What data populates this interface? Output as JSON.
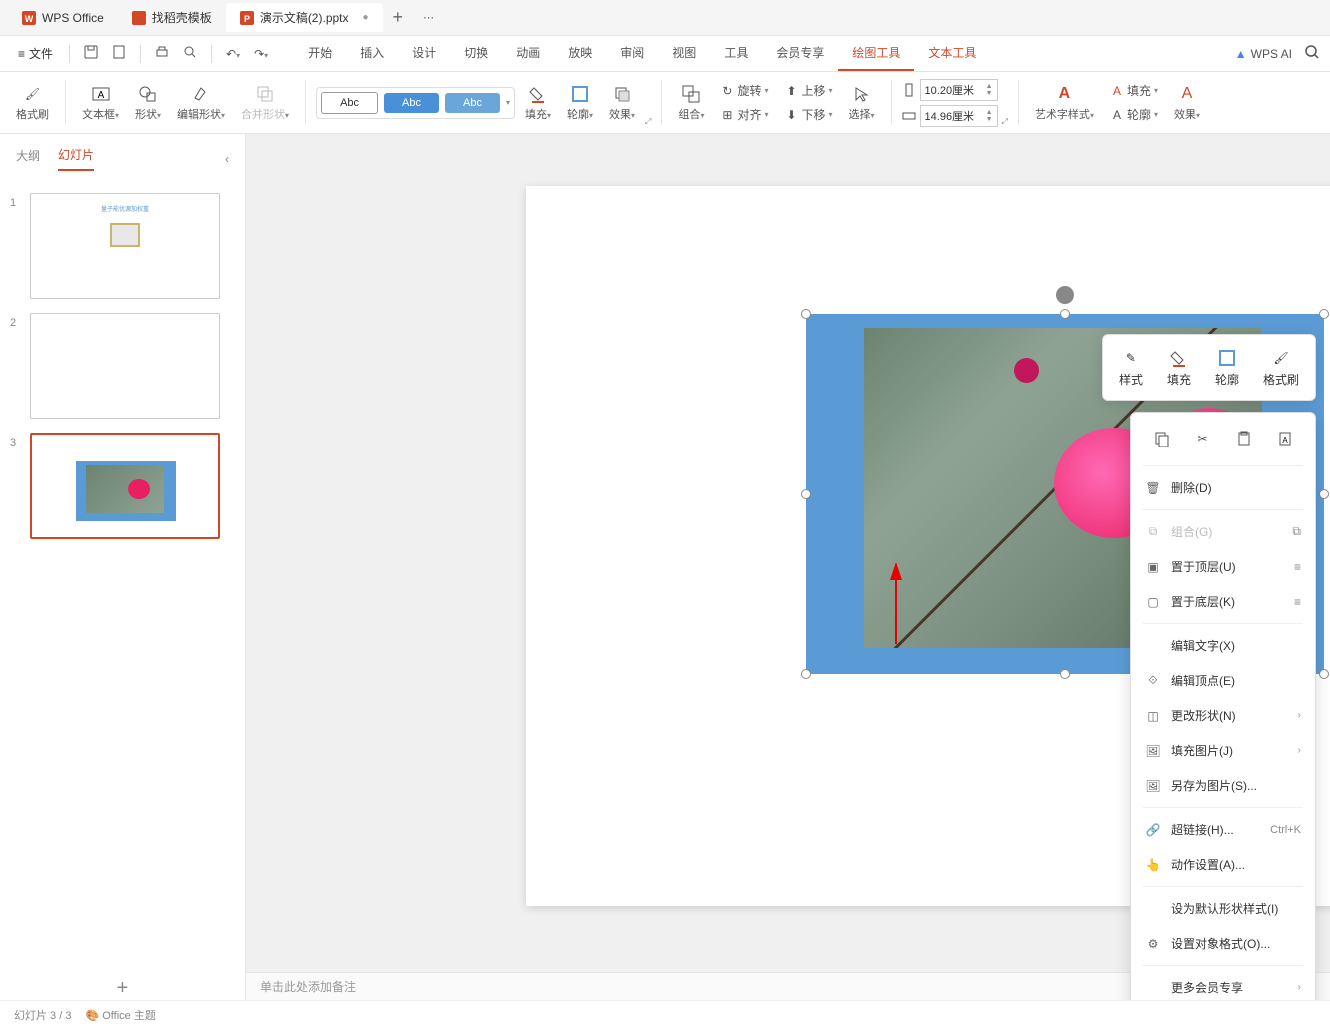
{
  "tabs": {
    "wps": "WPS Office",
    "template": "找稻壳模板",
    "doc": "演示文稿(2).pptx"
  },
  "menu": {
    "file": "文件",
    "tabs": [
      "开始",
      "插入",
      "设计",
      "切换",
      "动画",
      "放映",
      "审阅",
      "视图",
      "工具",
      "会员专享",
      "绘图工具",
      "文本工具"
    ],
    "active_idx": 10,
    "ai": "WPS AI"
  },
  "ribbon": {
    "format_painter": "格式刷",
    "textbox": "文本框",
    "shapes": "形状",
    "edit_shape": "编辑形状",
    "merge_shape": "合并形状",
    "style_abc": "Abc",
    "fill": "填充",
    "outline": "轮廓",
    "effect": "效果",
    "group": "组合",
    "rotate": "旋转",
    "align": "对齐",
    "up": "上移",
    "down": "下移",
    "select": "选择",
    "width": "10.20厘米",
    "height": "14.96厘米",
    "art_style": "艺术字样式",
    "t_fill": "填充",
    "t_outline": "轮廓",
    "t_effect": "效果"
  },
  "side": {
    "outline": "大纲",
    "slides": "幻灯片",
    "n1": "1",
    "n2": "2",
    "n3": "3",
    "slide1_title": "量子能优源加权重"
  },
  "float": {
    "style": "样式",
    "fill": "填充",
    "outline": "轮廓",
    "painter": "格式刷"
  },
  "ctx": {
    "delete": "删除(D)",
    "group": "组合(G)",
    "top": "置于顶层(U)",
    "bottom": "置于底层(K)",
    "edit_text": "编辑文字(X)",
    "edit_points": "编辑顶点(E)",
    "change_shape": "更改形状(N)",
    "fill_pic": "填充图片(J)",
    "save_as_pic": "另存为图片(S)...",
    "hyperlink": "超链接(H)...",
    "hyperlink_sc": "Ctrl+K",
    "action": "动作设置(A)...",
    "default_shape": "设为默认形状样式(I)",
    "obj_format": "设置对象格式(O)...",
    "more_vip": "更多会员专享"
  },
  "notes": "单击此处添加备注",
  "status": {
    "slide": "幻灯片 3 / 3",
    "theme": "Office 主题"
  }
}
